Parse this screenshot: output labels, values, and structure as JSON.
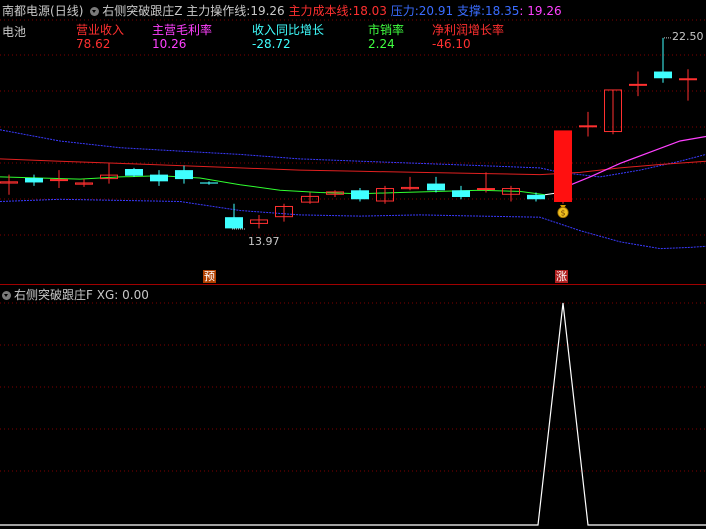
{
  "header": {
    "stock": "南都电源",
    "period": "(日线)",
    "indicator": "右侧突破跟庄Z",
    "line1_label": "主力操作线:",
    "line1_value": "19.26",
    "line2_label": "主力成本线:",
    "line2_value": "18.03",
    "pressure_label": "压力:",
    "pressure_value": "20.91",
    "support_label": "支撑:",
    "support_value": "18.35",
    "extra_value": ": 19.26",
    "colors": {
      "line1": "#c8c8c8",
      "line2": "#ff3030",
      "pressure": "#3a6cff",
      "support": "#3a6cff",
      "extra": "#ff40ff"
    }
  },
  "fundamentals": {
    "sector": "电池",
    "items": [
      {
        "label": "营业收入",
        "value": "78.62",
        "color": "#ff3030"
      },
      {
        "label": "主营毛利率",
        "value": "10.26",
        "color": "#ff40ff"
      },
      {
        "label": "收入同比增长",
        "value": "-28.72",
        "color": "#40ffff"
      },
      {
        "label": "市销率",
        "value": "2.24",
        "color": "#40ff40"
      },
      {
        "label": "净利润增长率",
        "value": "-46.10",
        "color": "#ff3030"
      }
    ]
  },
  "main_chart": {
    "high_label": "22.50",
    "low_label": "13.97",
    "marker_pre": "预",
    "marker_up": "涨",
    "money_icon": "money-bag-icon",
    "price_range": [
      12.5,
      23.3
    ],
    "colors": {
      "up": "#ff3030",
      "down": "#40ffff",
      "ma_white": "#ffffff",
      "ma_red": "#e02020",
      "ma_green": "#30ff30",
      "ma_magenta": "#ff40ff",
      "band": "#3a3aff",
      "grid": "#800000"
    }
  },
  "sub_chart": {
    "indicator": "右侧突破跟庄F",
    "xg_label": "XG:",
    "xg_value": "0.00",
    "signal_value": 1
  }
}
